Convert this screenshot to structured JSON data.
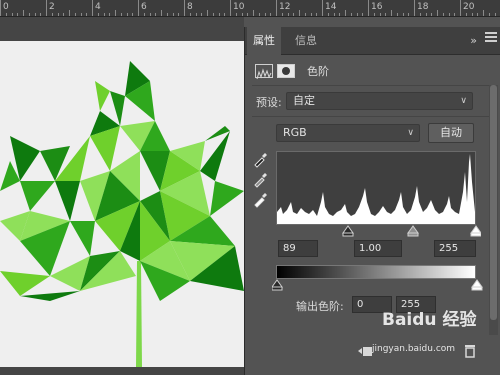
{
  "ruler": {
    "labels": [
      "0",
      "2",
      "4",
      "6",
      "8",
      "10",
      "12",
      "14",
      "16",
      "18",
      "20"
    ]
  },
  "panel": {
    "tabs": [
      {
        "label": "属性",
        "active": true
      },
      {
        "label": "信息",
        "active": false
      }
    ],
    "collapse_icon": "double-chevron-right-icon",
    "menu_icon": "menu-icon",
    "adjustment_title": "色阶",
    "preset_label": "预设:",
    "preset_value": "自定",
    "channel_value": "RGB",
    "auto_button": "自动",
    "input_black": "89",
    "input_gamma": "1.00",
    "input_white": "255",
    "output_label": "输出色阶:",
    "output_black": "0",
    "output_white": "255"
  },
  "watermark": {
    "text_main": "Baidu 经验",
    "text_url": "jingyan.baidu.com"
  },
  "colors": {
    "leaf_dark": "#0e7a0e",
    "leaf_mid": "#2fa81d",
    "leaf_light": "#8fe05a",
    "leaf_bright": "#6fd02c"
  }
}
